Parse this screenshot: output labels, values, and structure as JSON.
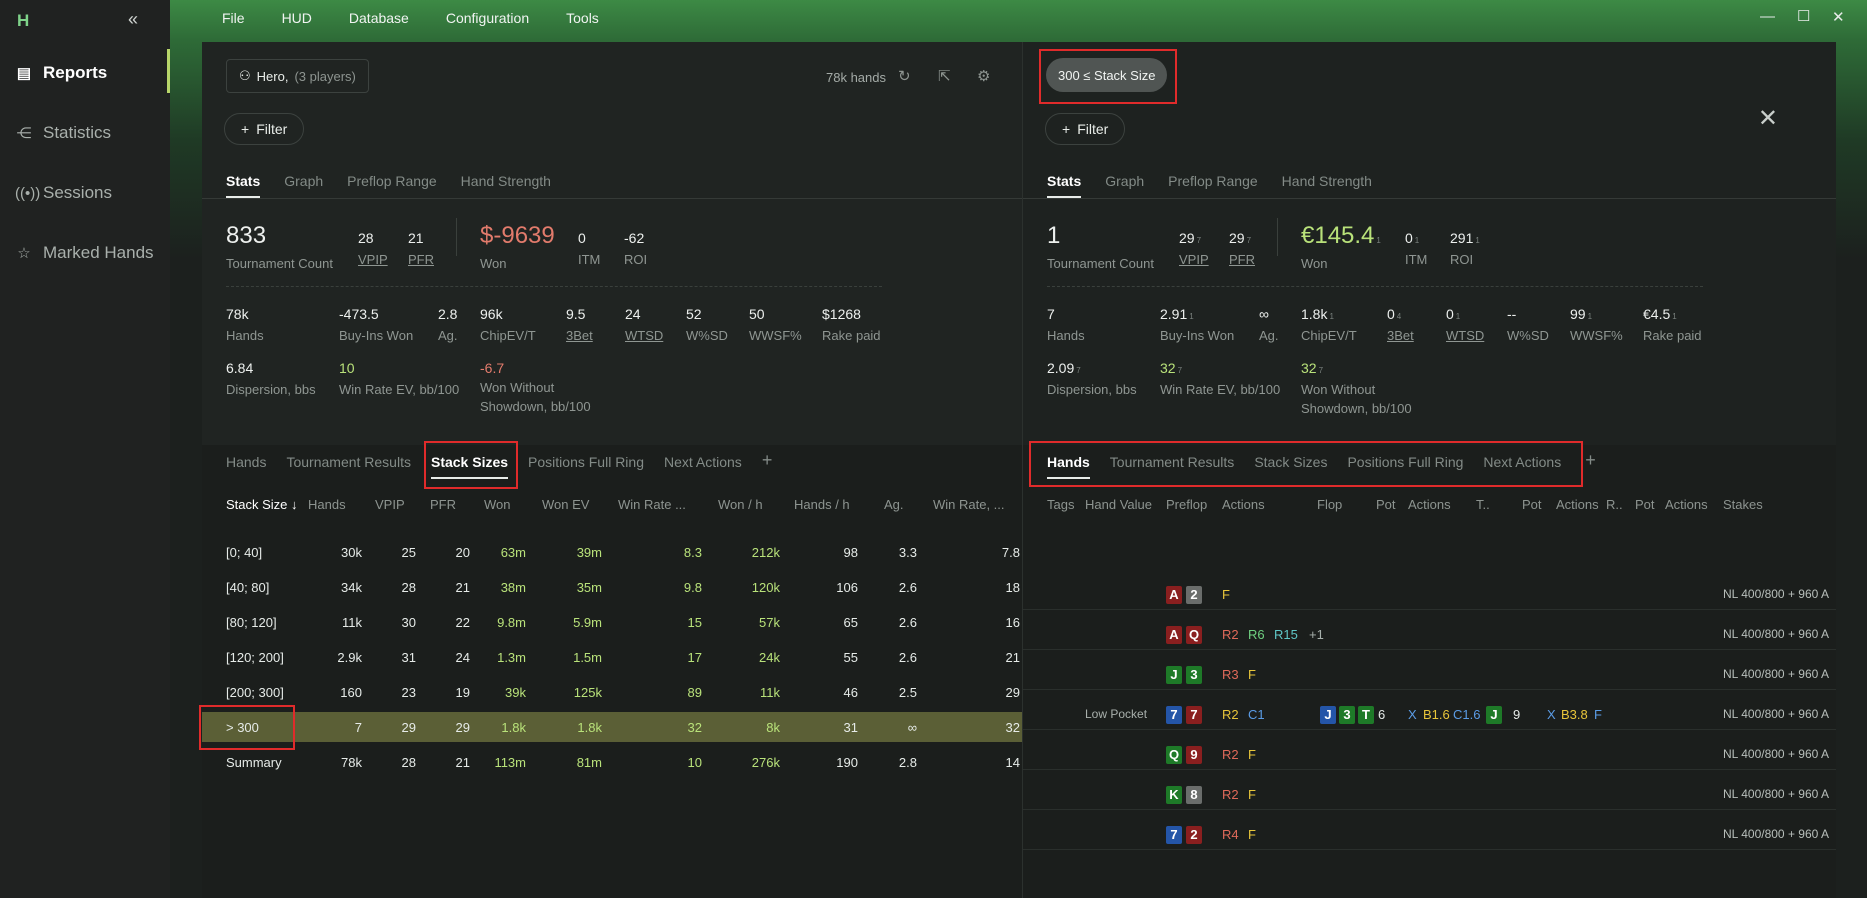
{
  "app": {
    "logo": "H",
    "collapse": "«"
  },
  "sidebar": {
    "items": [
      {
        "label": "Reports",
        "icon": "document-icon"
      },
      {
        "label": "Statistics",
        "icon": "share-icon"
      },
      {
        "label": "Sessions",
        "icon": "broadcast-icon"
      },
      {
        "label": "Marked Hands",
        "icon": "star-list-icon"
      }
    ]
  },
  "menu": [
    "File",
    "HUD",
    "Database",
    "Configuration",
    "Tools"
  ],
  "left": {
    "player_label": "Hero,",
    "player_sub": "(3 players)",
    "filter_label": "Filter",
    "hands_count": "78k hands",
    "tabs": [
      "Stats",
      "Graph",
      "Preflop Range",
      "Hand Strength"
    ],
    "top_stats": {
      "tournament_count": "833",
      "tournament_count_label": "Tournament Count",
      "vpip": "28",
      "vpip_label": "VPIP",
      "pfr": "21",
      "pfr_label": "PFR",
      "won": "$-9639",
      "won_label": "Won",
      "itm": "0",
      "itm_label": "ITM",
      "roi": "-62",
      "roi_label": "ROI"
    },
    "row2": [
      {
        "v": "78k",
        "l": "Hands"
      },
      {
        "v": "-473.5",
        "l": "Buy-Ins Won"
      },
      {
        "v": "2.8",
        "l": "Ag."
      },
      {
        "v": "96k",
        "l": "ChipEV/T"
      },
      {
        "v": "9.5",
        "l": "3Bet"
      },
      {
        "v": "24",
        "l": "WTSD"
      },
      {
        "v": "52",
        "l": "W%SD"
      },
      {
        "v": "50",
        "l": "WWSF%"
      },
      {
        "v": "$1268",
        "l": "Rake paid"
      }
    ],
    "row3": [
      {
        "v": "6.84",
        "l": "Dispersion, bbs"
      },
      {
        "v": "10",
        "l": "Win Rate EV, bb/100"
      },
      {
        "v": "-6.7",
        "l": "Won Without",
        "l2": "Showdown, bb/100"
      }
    ],
    "lower_tabs": [
      "Hands",
      "Tournament Results",
      "Stack Sizes",
      "Positions Full Ring",
      "Next Actions",
      "+"
    ],
    "table_headers": [
      "Stack Size ↓",
      "Hands",
      "VPIP",
      "PFR",
      "Won",
      "Won EV",
      "Win Rate ...",
      "Won / h",
      "Hands / h",
      "Ag.",
      "Win Rate, ..."
    ],
    "rows": [
      [
        "[0; 40]",
        "30k",
        "25",
        "20",
        "63m",
        "39m",
        "8.3",
        "212k",
        "98",
        "3.3",
        "7.8"
      ],
      [
        "[40; 80]",
        "34k",
        "28",
        "21",
        "38m",
        "35m",
        "9.8",
        "120k",
        "106",
        "2.6",
        "18"
      ],
      [
        "[80; 120]",
        "11k",
        "30",
        "22",
        "9.8m",
        "5.9m",
        "15",
        "57k",
        "65",
        "2.6",
        "16"
      ],
      [
        "[120; 200]",
        "2.9k",
        "31",
        "24",
        "1.3m",
        "1.5m",
        "17",
        "24k",
        "55",
        "2.6",
        "21"
      ],
      [
        "[200; 300]",
        "160",
        "23",
        "19",
        "39k",
        "125k",
        "89",
        "11k",
        "46",
        "2.5",
        "29"
      ],
      [
        "> 300",
        "7",
        "29",
        "29",
        "1.8k",
        "1.8k",
        "32",
        "8k",
        "31",
        "∞",
        "32"
      ],
      [
        "Summary",
        "78k",
        "28",
        "21",
        "113m",
        "81m",
        "10",
        "276k",
        "190",
        "2.8",
        "14"
      ]
    ]
  },
  "right": {
    "pill": "300 ≤ Stack Size",
    "close": "✕",
    "filter_label": "Filter",
    "tabs": [
      "Stats",
      "Graph",
      "Preflop Range",
      "Hand Strength"
    ],
    "top_stats": {
      "tournament_count": "1",
      "tournament_count_label": "Tournament Count",
      "vpip": "29",
      "vpip_sup": "7",
      "vpip_label": "VPIP",
      "pfr": "29",
      "pfr_sup": "7",
      "pfr_label": "PFR",
      "won": "€145.4",
      "won_sup": "1",
      "won_label": "Won",
      "itm": "0",
      "itm_sup": "1",
      "itm_label": "ITM",
      "roi": "291",
      "roi_sup": "1",
      "roi_label": "ROI"
    },
    "row2": [
      {
        "v": "7",
        "s": "",
        "l": "Hands"
      },
      {
        "v": "2.91",
        "s": "1",
        "l": "Buy-Ins Won"
      },
      {
        "v": "∞",
        "s": "",
        "l": "Ag."
      },
      {
        "v": "1.8k",
        "s": "1",
        "l": "ChipEV/T"
      },
      {
        "v": "0",
        "s": "4",
        "l": "3Bet"
      },
      {
        "v": "0",
        "s": "1",
        "l": "WTSD"
      },
      {
        "v": "--",
        "s": "",
        "l": "W%SD"
      },
      {
        "v": "99",
        "s": "1",
        "l": "WWSF%"
      },
      {
        "v": "€4.5",
        "s": "1",
        "l": "Rake paid"
      }
    ],
    "row3": [
      {
        "v": "2.09",
        "s": "7",
        "l": "Dispersion, bbs"
      },
      {
        "v": "32",
        "s": "7",
        "l": "Win Rate EV, bb/100"
      },
      {
        "v": "32",
        "s": "7",
        "l": "Won Without",
        "l2": "Showdown, bb/100"
      }
    ],
    "lower_tabs": [
      "Hands",
      "Tournament Results",
      "Stack Sizes",
      "Positions Full Ring",
      "Next Actions",
      "+"
    ],
    "hand_headers": [
      "Tags",
      "Hand Value",
      "Preflop",
      "Actions",
      "Flop",
      "Pot",
      "Actions",
      "T..",
      "Pot",
      "Actions",
      "R..",
      "Pot",
      "Actions",
      "Stakes"
    ],
    "stakes": "NL 400/800 + 960 A",
    "hands": [
      {
        "cards": [
          "A",
          "2"
        ],
        "actions": [
          "F"
        ]
      },
      {
        "cards": [
          "A",
          "Q"
        ],
        "actions": [
          "R2",
          "R6",
          "R15",
          "+1"
        ]
      },
      {
        "cards": [
          "J",
          "3"
        ],
        "actions": [
          "R3",
          "F"
        ]
      },
      {
        "hand_value": "Low Pocket",
        "cards": [
          "7",
          "7"
        ],
        "actions": [
          "R2",
          "C1"
        ],
        "flop": [
          "J",
          "3",
          "T"
        ],
        "flop_pot": "6",
        "flop_actions": [
          "X",
          "B1.6",
          "C1.6"
        ],
        "turn": "J",
        "turn_pot": "9",
        "turn_actions": [
          "X",
          "B3.8",
          "F"
        ]
      },
      {
        "cards": [
          "Q",
          "9"
        ],
        "actions": [
          "R2",
          "F"
        ]
      },
      {
        "cards": [
          "K",
          "8"
        ],
        "actions": [
          "R2",
          "F"
        ]
      },
      {
        "cards": [
          "7",
          "2"
        ],
        "actions": [
          "R4",
          "F"
        ]
      }
    ]
  }
}
